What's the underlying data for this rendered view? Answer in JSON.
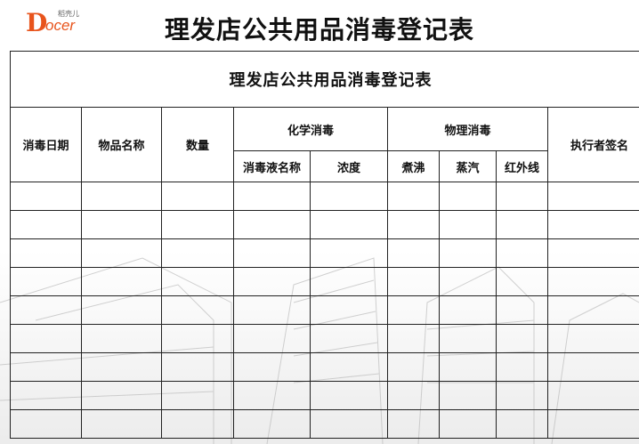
{
  "logo": {
    "letter": "D",
    "text": "ocer",
    "small_text": "稻壳儿"
  },
  "document": {
    "title": "理发店公共用品消毒登记表"
  },
  "table": {
    "title": "理发店公共用品消毒登记表",
    "headers": {
      "date": "消毒日期",
      "item_name": "物品名称",
      "quantity": "数量",
      "chemical": "化学消毒",
      "physical": "物理消毒",
      "executor": "执行者签名",
      "disinfectant_name": "消毒液名称",
      "concentration": "浓度",
      "boiling": "煮沸",
      "steam": "蒸汽",
      "uv": "红外线"
    },
    "row_count": 9
  },
  "colors": {
    "logo": "#e8541c",
    "border": "#222222",
    "text": "#111111"
  }
}
